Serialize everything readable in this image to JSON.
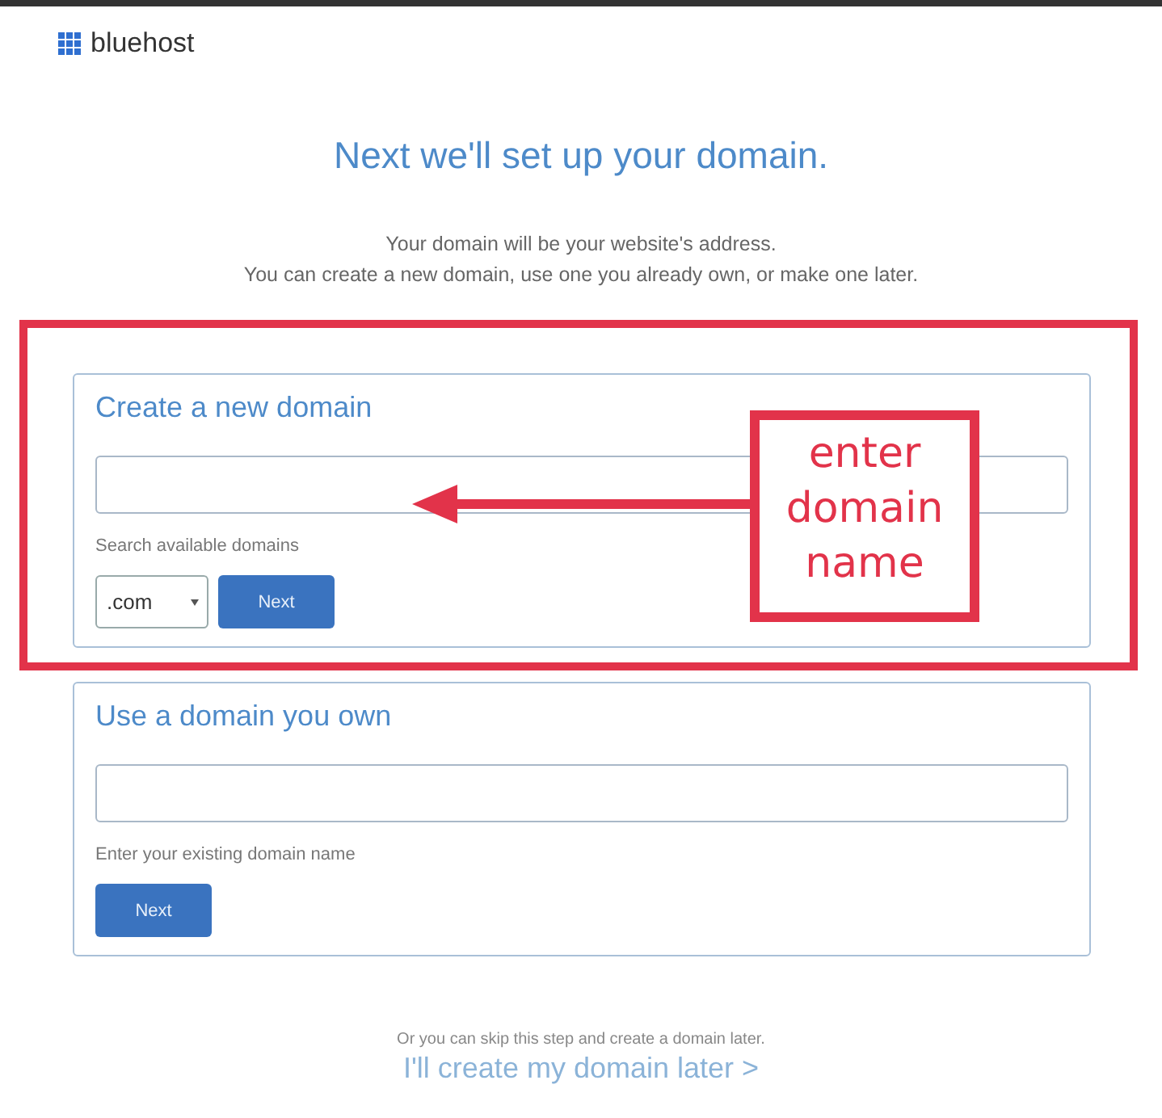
{
  "logo": {
    "text": "bluehost"
  },
  "heading": "Next we'll set up your domain.",
  "intro": [
    "Your domain will be your website's address.",
    "You can create a new domain, use one you already own, or make one later."
  ],
  "sections": [
    {
      "title": "Create a new domain",
      "hint": "Search available domains",
      "tld": ".com",
      "button": "Next",
      "highlighted": true,
      "annotation": "enter domain name"
    },
    {
      "title": "Use a domain you own",
      "hint": "Enter your existing domain name",
      "button": "Next",
      "highlighted": false
    }
  ],
  "footer": {
    "note": "Or you can skip this step and create a domain later.",
    "link": "I'll create my domain later",
    "link_icon": ">"
  }
}
